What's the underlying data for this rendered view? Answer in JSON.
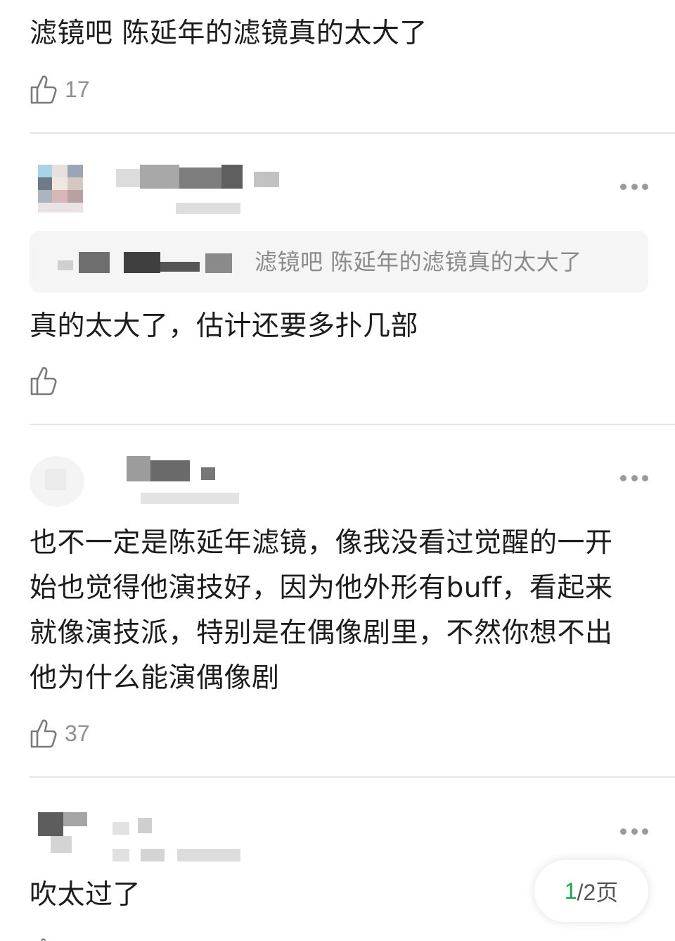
{
  "comments": [
    {
      "text": "滤镜吧 陈延年的滤镜真的太大了",
      "likes": "17",
      "like_icon": "thumbs-up-icon"
    },
    {
      "quote": "滤镜吧 陈延年的滤镜真的太大了",
      "text": "真的太大了，估计还要多扑几部",
      "likes": "",
      "like_icon": "thumbs-up-icon",
      "more_icon": "more-dots-icon"
    },
    {
      "text": "也不一定是陈延年滤镜，像我没看过觉醒的一开始也觉得他演技好，因为他外形有buff，看起来就像演技派，特别是在偶像剧里，不然你想不出他为什么能演偶像剧",
      "likes": "37",
      "like_icon": "thumbs-up-icon",
      "more_icon": "more-dots-icon"
    },
    {
      "text": "吹太过了",
      "more_icon": "more-dots-icon"
    }
  ],
  "pager": {
    "current": "1",
    "total": "/2页"
  },
  "colors": {
    "accent": "#18a84a",
    "muted": "#8f8f8f",
    "divider": "#e6e6e6",
    "quote_bg": "#f5f5f5"
  }
}
